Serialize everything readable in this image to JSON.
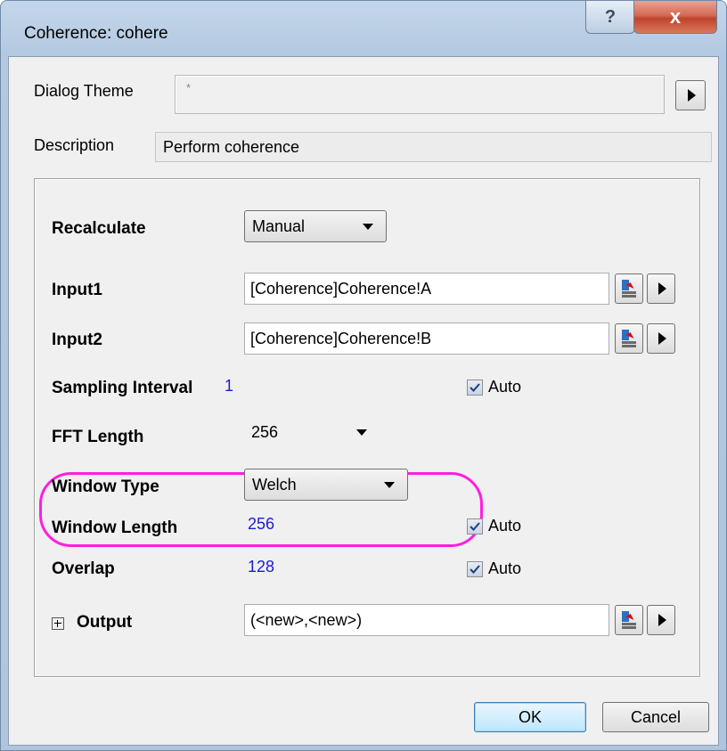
{
  "window": {
    "title": "Coherence: cohere",
    "help_label": "?",
    "close_label": "x"
  },
  "theme": {
    "label": "Dialog Theme",
    "value": "*"
  },
  "description": {
    "label": "Description",
    "value": "Perform coherence"
  },
  "rows": {
    "recalculate": {
      "label": "Recalculate",
      "value": "Manual"
    },
    "input1": {
      "label": "Input1",
      "value": "[Coherence]Coherence!A"
    },
    "input2": {
      "label": "Input2",
      "value": "[Coherence]Coherence!B"
    },
    "sampling_interval": {
      "label": "Sampling Interval",
      "value": "1",
      "auto_label": "Auto",
      "auto_checked": true
    },
    "fft_length": {
      "label": "FFT Length",
      "value": "256"
    },
    "window_type": {
      "label": "Window Type",
      "value": "Welch"
    },
    "window_length": {
      "label": "Window Length",
      "value": "256",
      "auto_label": "Auto",
      "auto_checked": true
    },
    "overlap": {
      "label": "Overlap",
      "value": "128",
      "auto_label": "Auto",
      "auto_checked": true
    },
    "output": {
      "label": "Output",
      "value": "(<new>,<new>)"
    }
  },
  "buttons": {
    "ok": "OK",
    "cancel": "Cancel"
  },
  "colors": {
    "highlight": "#ff1ee0",
    "value_blue": "#1b1bd4"
  }
}
